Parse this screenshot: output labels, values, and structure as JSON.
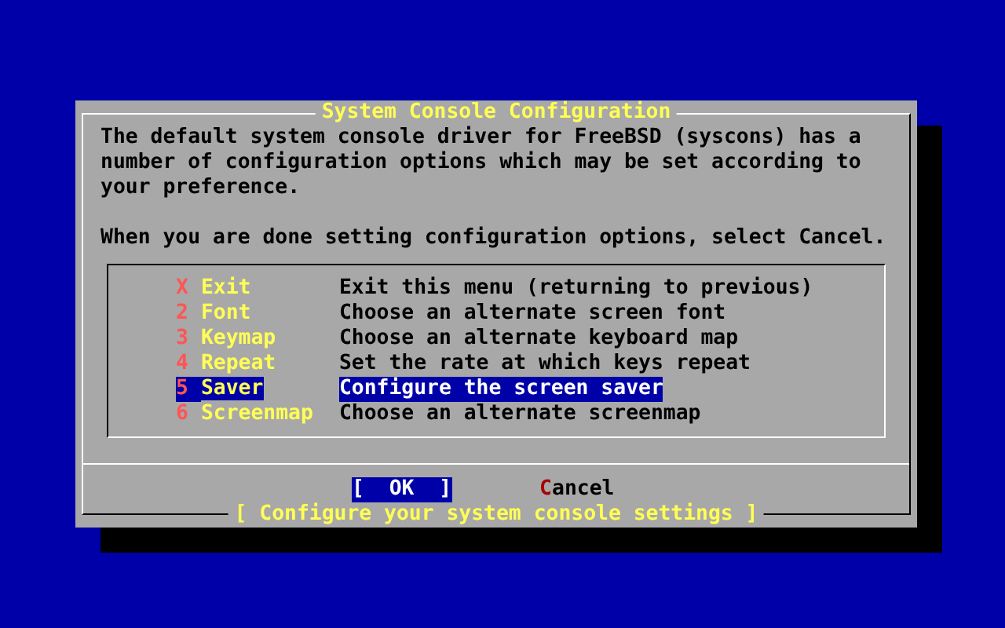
{
  "dialog": {
    "title": "System Console Configuration",
    "message": "The default system console driver for FreeBSD (syscons) has a number of configuration options which may be set according to your preference.",
    "prompt": "When you are done setting configuration options, select Cancel.",
    "menu": [
      {
        "key": "X",
        "label": "Exit",
        "description": "Exit this menu (returning to previous)",
        "selected": false
      },
      {
        "key": "2",
        "label": "Font",
        "description": "Choose an alternate screen font",
        "selected": false
      },
      {
        "key": "3",
        "label": "Keymap",
        "description": "Choose an alternate keyboard map",
        "selected": false
      },
      {
        "key": "4",
        "label": "Repeat",
        "description": "Set the rate at which keys repeat",
        "selected": false
      },
      {
        "key": "5",
        "label": "Saver",
        "description": "Configure the screen saver",
        "selected": true
      },
      {
        "key": "6",
        "label": "Screenmap",
        "description": "Choose an alternate screenmap",
        "selected": false
      }
    ],
    "buttons": [
      {
        "label": "[  OK  ]",
        "selected": true
      },
      {
        "label": "Cancel",
        "selected": false
      }
    ],
    "footer": "[ Configure your system console settings ]"
  }
}
